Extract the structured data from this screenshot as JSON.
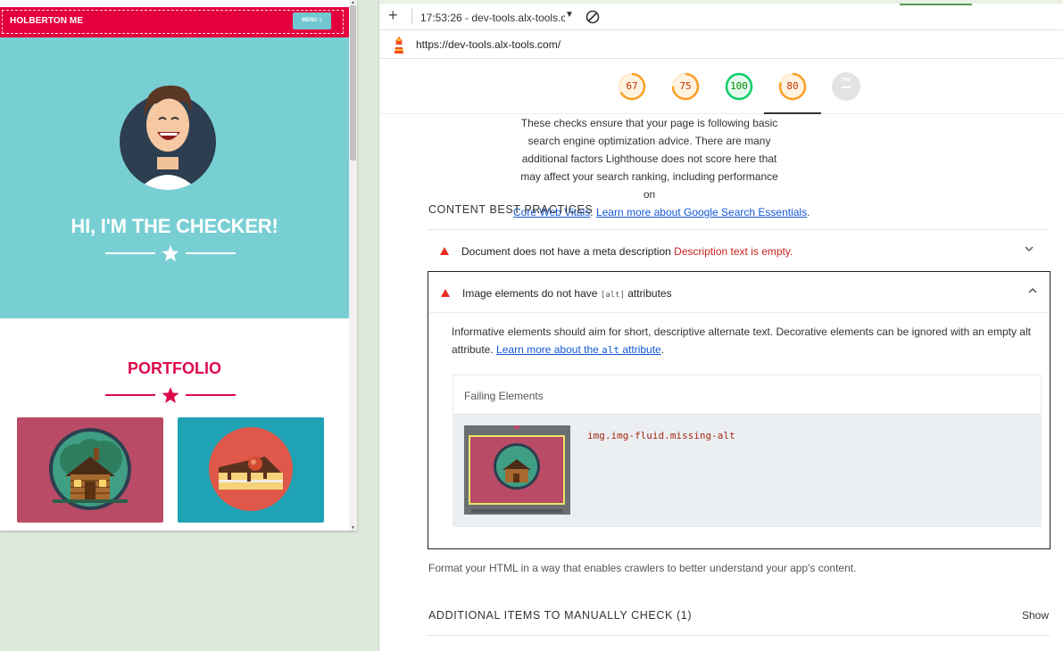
{
  "preview": {
    "brand": "HOLBERTON ME",
    "menu_label": "MENU ≡",
    "hero_title": "HI, I'M THE CHECKER!",
    "portfolio_title": "PORTFOLIO"
  },
  "devtools": {
    "report_time": "17:53:26 - dev-tools.alx-tools.c",
    "url": "https://dev-tools.alx-tools.com/",
    "scores": [
      {
        "value": 67,
        "fraction": 0.67,
        "color": "#fa9f24"
      },
      {
        "value": 75,
        "fraction": 0.75,
        "color": "#fa9f24"
      },
      {
        "value": 100,
        "fraction": 1.0,
        "color": "#0cce6b"
      },
      {
        "value": 80,
        "fraction": 0.8,
        "color": "#fa9f24"
      }
    ],
    "pwa_label": "PWA"
  },
  "seo": {
    "desc_1": "These checks ensure that your page is following basic search engine optimization advice. There are many additional factors Lighthouse does not score here that may affect your search ranking, including performance on",
    "link_cwv": "Core Web Vitals",
    "link_sep": ". ",
    "link_essentials": "Learn more about Google Search Essentials",
    "desc_end": "."
  },
  "content_section": {
    "title": "CONTENT BEST PRACTICES",
    "audit_meta": {
      "title": "Document does not have a meta description",
      "error": "Description text is empty."
    },
    "audit_alt": {
      "title_pre": "Image elements do not have",
      "title_code": "[alt]",
      "title_post": "attributes",
      "desc": "Informative elements should aim for short, descriptive alternate text. Decorative elements can be ignored with an empty alt attribute.",
      "learn_pre": "Learn more about the",
      "learn_code": "alt",
      "learn_post": "attribute",
      "learn_end": ".",
      "failing_header": "Failing Elements",
      "failing_selector": "img.img-fluid.missing-alt"
    },
    "footnote": "Format your HTML in a way that enables crawlers to better understand your app's content."
  },
  "manual_section": {
    "title": "ADDITIONAL ITEMS TO MANUALLY CHECK",
    "count": "(1)",
    "show_label": "Show"
  }
}
